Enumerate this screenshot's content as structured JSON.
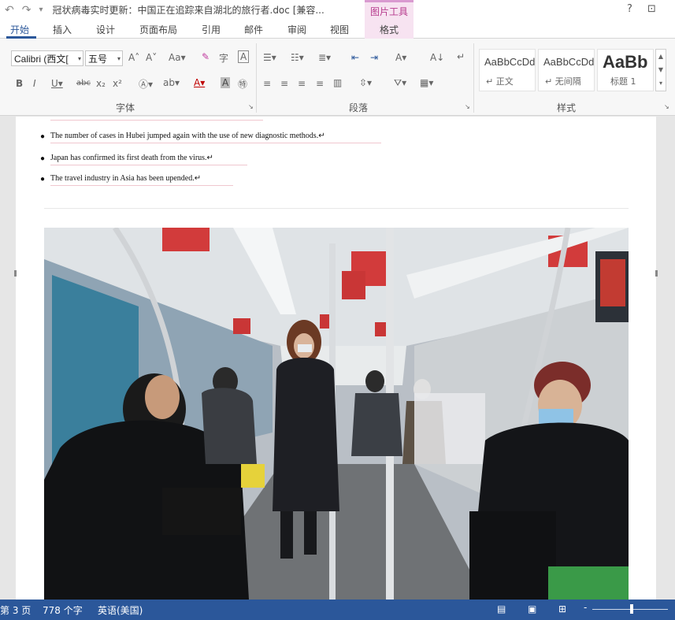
{
  "app": {
    "doc_title": "冠状病毒实时更新：中国正在追踪来自湖北的旅行者.doc [兼容...",
    "picture_tools": "图片工具",
    "help_label": "?",
    "ribbon_display_label": "⊡"
  },
  "tabs": [
    "开始",
    "插入",
    "设计",
    "页面布局",
    "引用",
    "邮件",
    "审阅",
    "视图"
  ],
  "format_tab": "格式",
  "ribbon": {
    "font_name": "Calibri (西文[",
    "font_size": "五号",
    "group_font": "字体",
    "group_paragraph": "段落",
    "group_styles": "样式",
    "styles": [
      {
        "sample": "AaBbCcDd",
        "name": "↵ 正文"
      },
      {
        "sample": "AaBbCcDd",
        "name": "↵ 无间隔"
      },
      {
        "sample": "AaBb",
        "name": "标题 1"
      }
    ]
  },
  "document": {
    "bullets": [
      "The number of cases in Hubei jumped again with the use of new diagnostic methods.↵",
      "Japan has confirmed its first death from the virus.↵",
      "The travel industry in Asia has been upended.↵"
    ]
  },
  "status": {
    "page": "第 3 页",
    "words": "778 个字",
    "language": "英语(美国)",
    "zoom_minus": "-"
  },
  "colors": {
    "accent": "#2b579a",
    "picture_tools_bg": "#f7e3f1",
    "picture_tools_text": "#b73c8e"
  }
}
